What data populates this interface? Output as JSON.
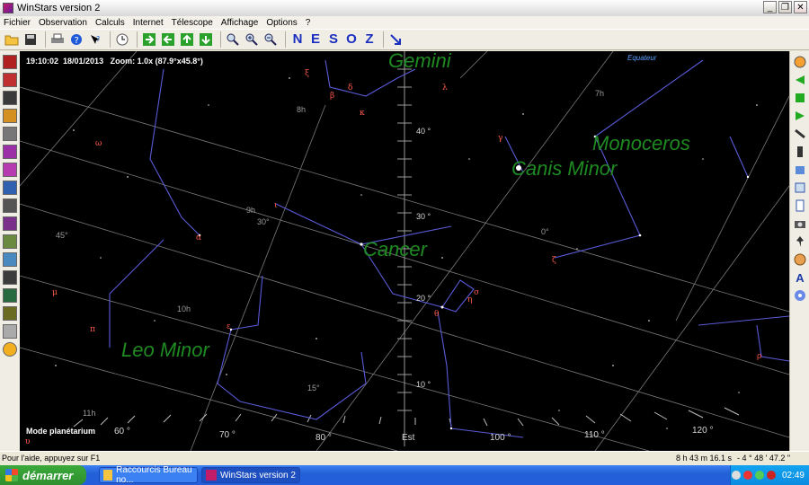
{
  "window": {
    "title": "WinStars version 2"
  },
  "window_buttons": {
    "minimize": "_",
    "maximize": "❐",
    "close": "✕"
  },
  "menu": [
    "Fichier",
    "Observation",
    "Calculs",
    "Internet",
    "Télescope",
    "Affichage",
    "Options",
    "?"
  ],
  "toolbar": {
    "icons": [
      "open-folder",
      "save",
      "print",
      "help",
      "whats-this",
      "clock",
      "arrow-right",
      "arrow-left",
      "arrow-up",
      "arrow-down",
      "zoom",
      "zoom-in",
      "zoom-out"
    ],
    "directions": [
      "N",
      "E",
      "S",
      "O",
      "Z"
    ]
  },
  "sky": {
    "info_line": "19:10:02  18/01/2013   Zoom: 1.0x (87.9°x45.8°)",
    "mode": "Mode planétarium",
    "equator_label": "Equateur",
    "constellations": [
      "Gemini",
      "Monoceros",
      "Canis Minor",
      "Cancer",
      "Leo Minor"
    ],
    "altitude_labels": [
      "40 °",
      "30 °",
      "20 °",
      "10 °"
    ],
    "azimuth_labels": [
      "60 °",
      "70 °",
      "80 °",
      "Est",
      "100 °",
      "110 °",
      "120 °"
    ],
    "ra_labels": [
      "7h",
      "8h",
      "9h",
      "10h",
      "11h"
    ],
    "dec_labels": [
      "0°",
      "15°",
      "30°",
      "45°"
    ],
    "greek_labels": [
      "α",
      "β",
      "γ",
      "δ",
      "ε",
      "ζ",
      "η",
      "θ",
      "ι",
      "κ",
      "λ",
      "μ",
      "ρ",
      "σ",
      "υ",
      "ξ",
      "ω",
      "π"
    ]
  },
  "status": {
    "hint": "Pour l'aide, appuyez sur F1",
    "ra": "8 h  43 m  16.1 s",
    "dec": "- 4 °  48 '  47.2 \""
  },
  "taskbar": {
    "start": "démarrer",
    "tasks": [
      "Raccourcis Bureau no...",
      "WinStars version 2"
    ],
    "clock": "02:49"
  },
  "colors": {
    "sky": "#000000",
    "constellation_line": "#5a5ad8",
    "constellation_name": "#1f8a22",
    "greek_label": "#ff5a4a",
    "grid": "#8a8a8a",
    "taskbar": "#245edb"
  }
}
